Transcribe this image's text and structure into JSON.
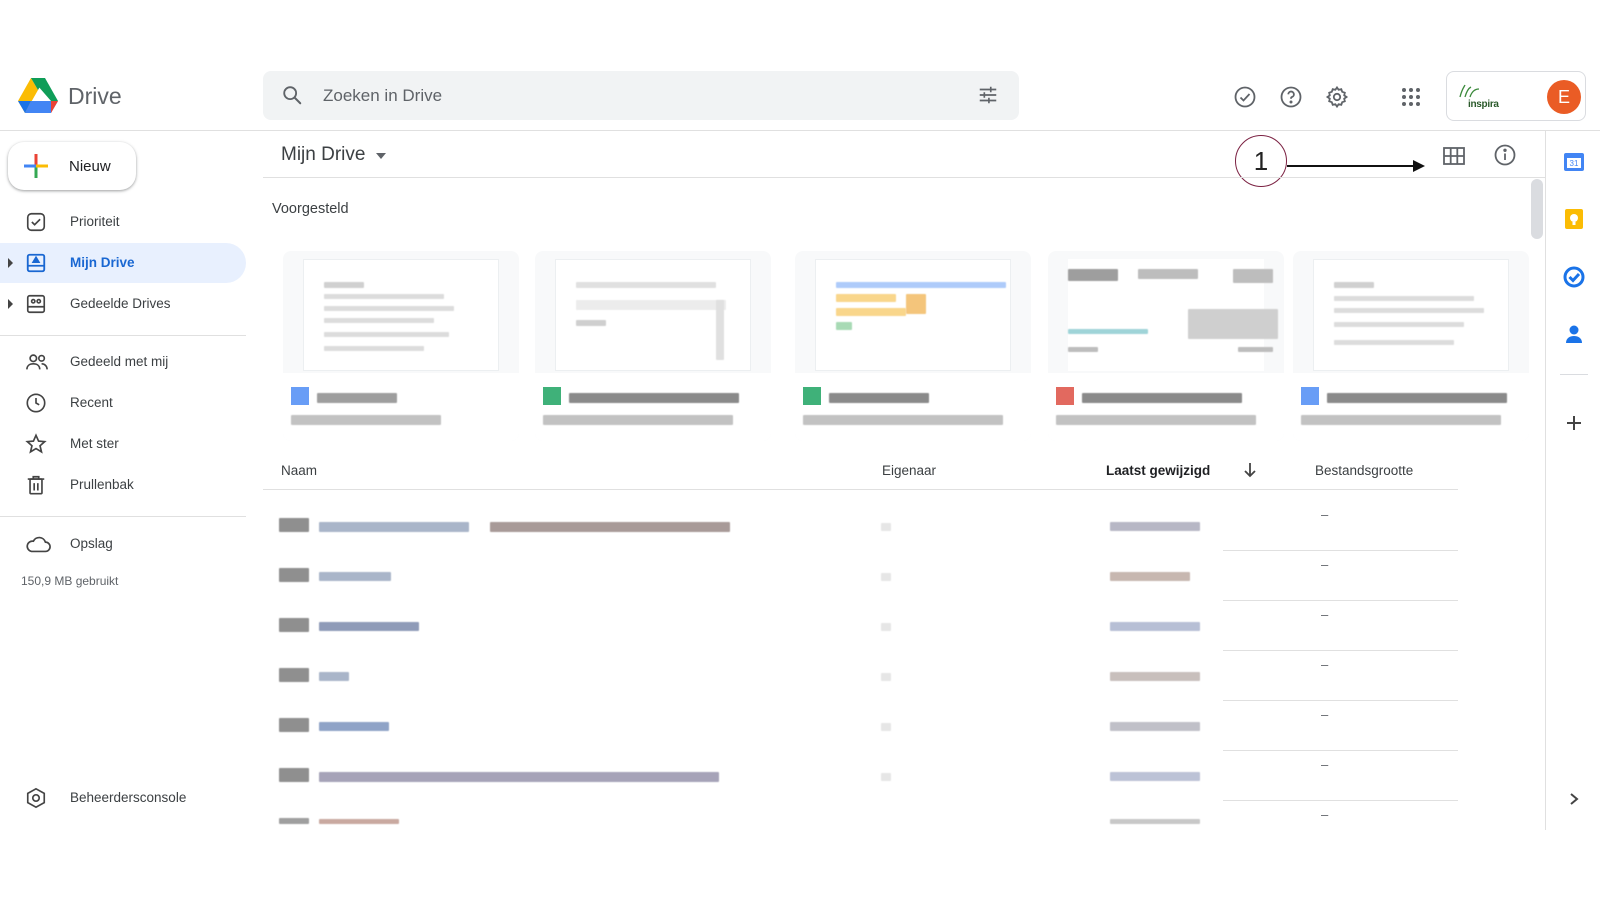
{
  "app": {
    "name": "Drive"
  },
  "search": {
    "placeholder": "Zoeken in Drive"
  },
  "header": {
    "icons": [
      "offline-ready-icon",
      "help-icon",
      "settings-icon",
      "apps-grid-icon"
    ],
    "org_logo_text": "inspira",
    "avatar_letter": "E"
  },
  "sidebar": {
    "new_label": "Nieuw",
    "items": [
      {
        "label": "Prioriteit",
        "icon": "priority-icon"
      },
      {
        "label": "Mijn Drive",
        "icon": "my-drive-icon",
        "active": true
      },
      {
        "label": "Gedeelde Drives",
        "icon": "shared-drives-icon"
      },
      {
        "label": "Gedeeld met mij",
        "icon": "shared-with-me-icon"
      },
      {
        "label": "Recent",
        "icon": "clock-icon"
      },
      {
        "label": "Met ster",
        "icon": "star-icon"
      },
      {
        "label": "Prullenbak",
        "icon": "trash-icon"
      },
      {
        "label": "Opslag",
        "icon": "cloud-icon"
      },
      {
        "label": "Beheerdersconsole",
        "icon": "admin-icon"
      }
    ],
    "storage_used": "150,9 MB gebruikt"
  },
  "main": {
    "breadcrumb": "Mijn Drive",
    "annotation": "1",
    "suggested_label": "Voorgesteld",
    "cards": [
      {
        "type_color": "#4285f4"
      },
      {
        "type_color": "#0f9d58"
      },
      {
        "type_color": "#0f9d58"
      },
      {
        "type_color": "#db4437"
      },
      {
        "type_color": "#4285f4"
      }
    ],
    "table": {
      "columns": [
        "Naam",
        "Eigenaar",
        "Laatst gewijzigd",
        "Bestandsgrootte"
      ],
      "rows": [
        {
          "size": "–"
        },
        {
          "size": "–"
        },
        {
          "size": "–"
        },
        {
          "size": "–"
        },
        {
          "size": "–"
        },
        {
          "size": "–"
        },
        {
          "size": "–"
        }
      ]
    }
  },
  "colors": {
    "accent": "#1967d2",
    "active_bg": "#e8f0fe",
    "avatar": "#ea5c25",
    "annotation_circle": "#7b2142"
  }
}
